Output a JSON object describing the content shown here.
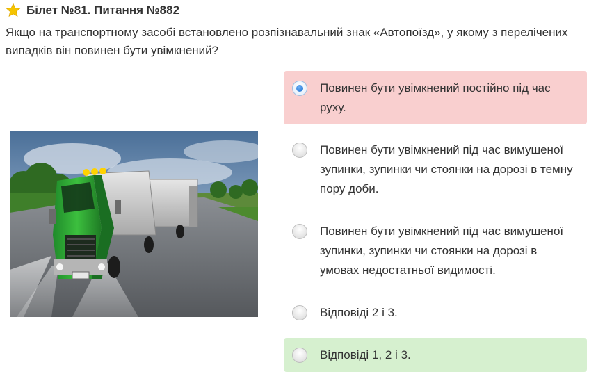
{
  "header": {
    "ticket_title": "Білет №81. Питання №882",
    "icon": "star-icon",
    "star_color": "#f5c400"
  },
  "question": {
    "text": "Якщо на транспортному засобі встановлено розпізнавальний знак «Автопоїзд», у якому з перелічених випадків він повинен бути увімкнений?"
  },
  "illustration": {
    "subject": "green-truck-with-trailer"
  },
  "answers": [
    {
      "text": "Повинен бути увімкнений постійно під час руху.",
      "state": "wrong-selected",
      "color": "#f9cfcf"
    },
    {
      "text": "Повинен бути увімкнений під час вимушеної зупинки, зупинки чи стоянки на дорозі в темну пору доби.",
      "state": "none"
    },
    {
      "text": "Повинен бути увімкнений під час вимушеної зупинки, зупинки чи стоянки на дорозі в умовах недостатньої видимості.",
      "state": "none"
    },
    {
      "text": "Відповіді 2 і 3.",
      "state": "none"
    },
    {
      "text": "Відповіді 1, 2 і 3.",
      "state": "correct",
      "color": "#d6f0cf"
    }
  ]
}
